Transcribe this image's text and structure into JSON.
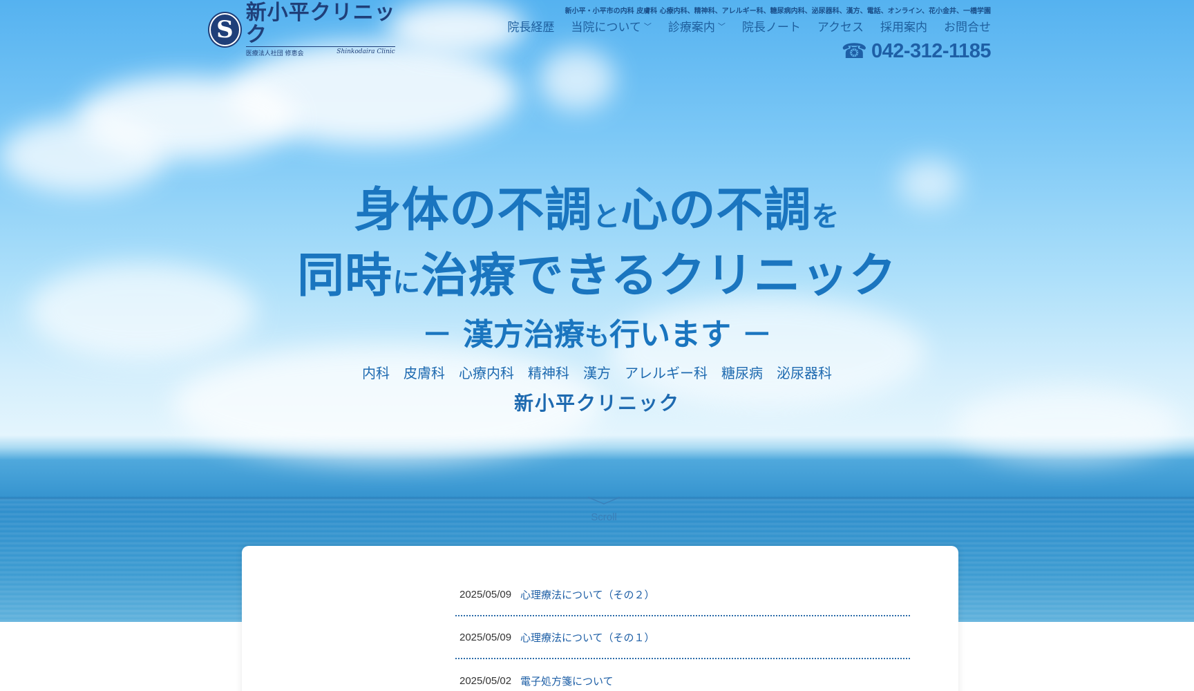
{
  "header": {
    "logo": {
      "mark": "S",
      "name": "新小平クリニック",
      "sub_ja": "医療法人社団 修恵会",
      "sub_en": "Shinkodaira Clinic"
    },
    "tagline": "新小平・小平市の内科 皮膚科 心療内科、精神科、アレルギー科、糖尿病内科、泌尿器科、漢方、電話、オンライン、花小金井、一橋学園",
    "nav": [
      {
        "label": "院長経歴",
        "has_dropdown": false
      },
      {
        "label": "当院について",
        "has_dropdown": true
      },
      {
        "label": "診療案内",
        "has_dropdown": true
      },
      {
        "label": "院長ノート",
        "has_dropdown": false
      },
      {
        "label": "アクセス",
        "has_dropdown": false
      },
      {
        "label": "採用案内",
        "has_dropdown": false
      },
      {
        "label": "お問合せ",
        "has_dropdown": false
      }
    ],
    "phone": {
      "icon": "phone-icon",
      "number": "042-312-1185"
    }
  },
  "hero": {
    "line1_a": "身体の不調",
    "line1_b": "と",
    "line1_c": "心の不調",
    "line1_d": "を",
    "line2_a": "同時",
    "line2_b": "に",
    "line2_c": "治療できるクリニック",
    "line3_a": "－ 漢方治療",
    "line3_b": "も",
    "line3_c": "行います －",
    "departments": [
      "内科",
      "皮膚科",
      "心療内科",
      "精神科",
      "漢方",
      "アレルギー科",
      "糖尿病",
      "泌尿器科"
    ],
    "clinic_name": "新小平クリニック",
    "scroll_label": "Scroll"
  },
  "news": [
    {
      "date": "2025/05/09",
      "title": "心理療法について（その２）"
    },
    {
      "date": "2025/05/09",
      "title": "心理療法について（その１）"
    },
    {
      "date": "2025/05/02",
      "title": "電子処方箋について"
    }
  ],
  "colors": {
    "brand_navy": "#1f3f79",
    "headline_blue": "#1a75bf",
    "link_blue": "#1e5fa6"
  }
}
